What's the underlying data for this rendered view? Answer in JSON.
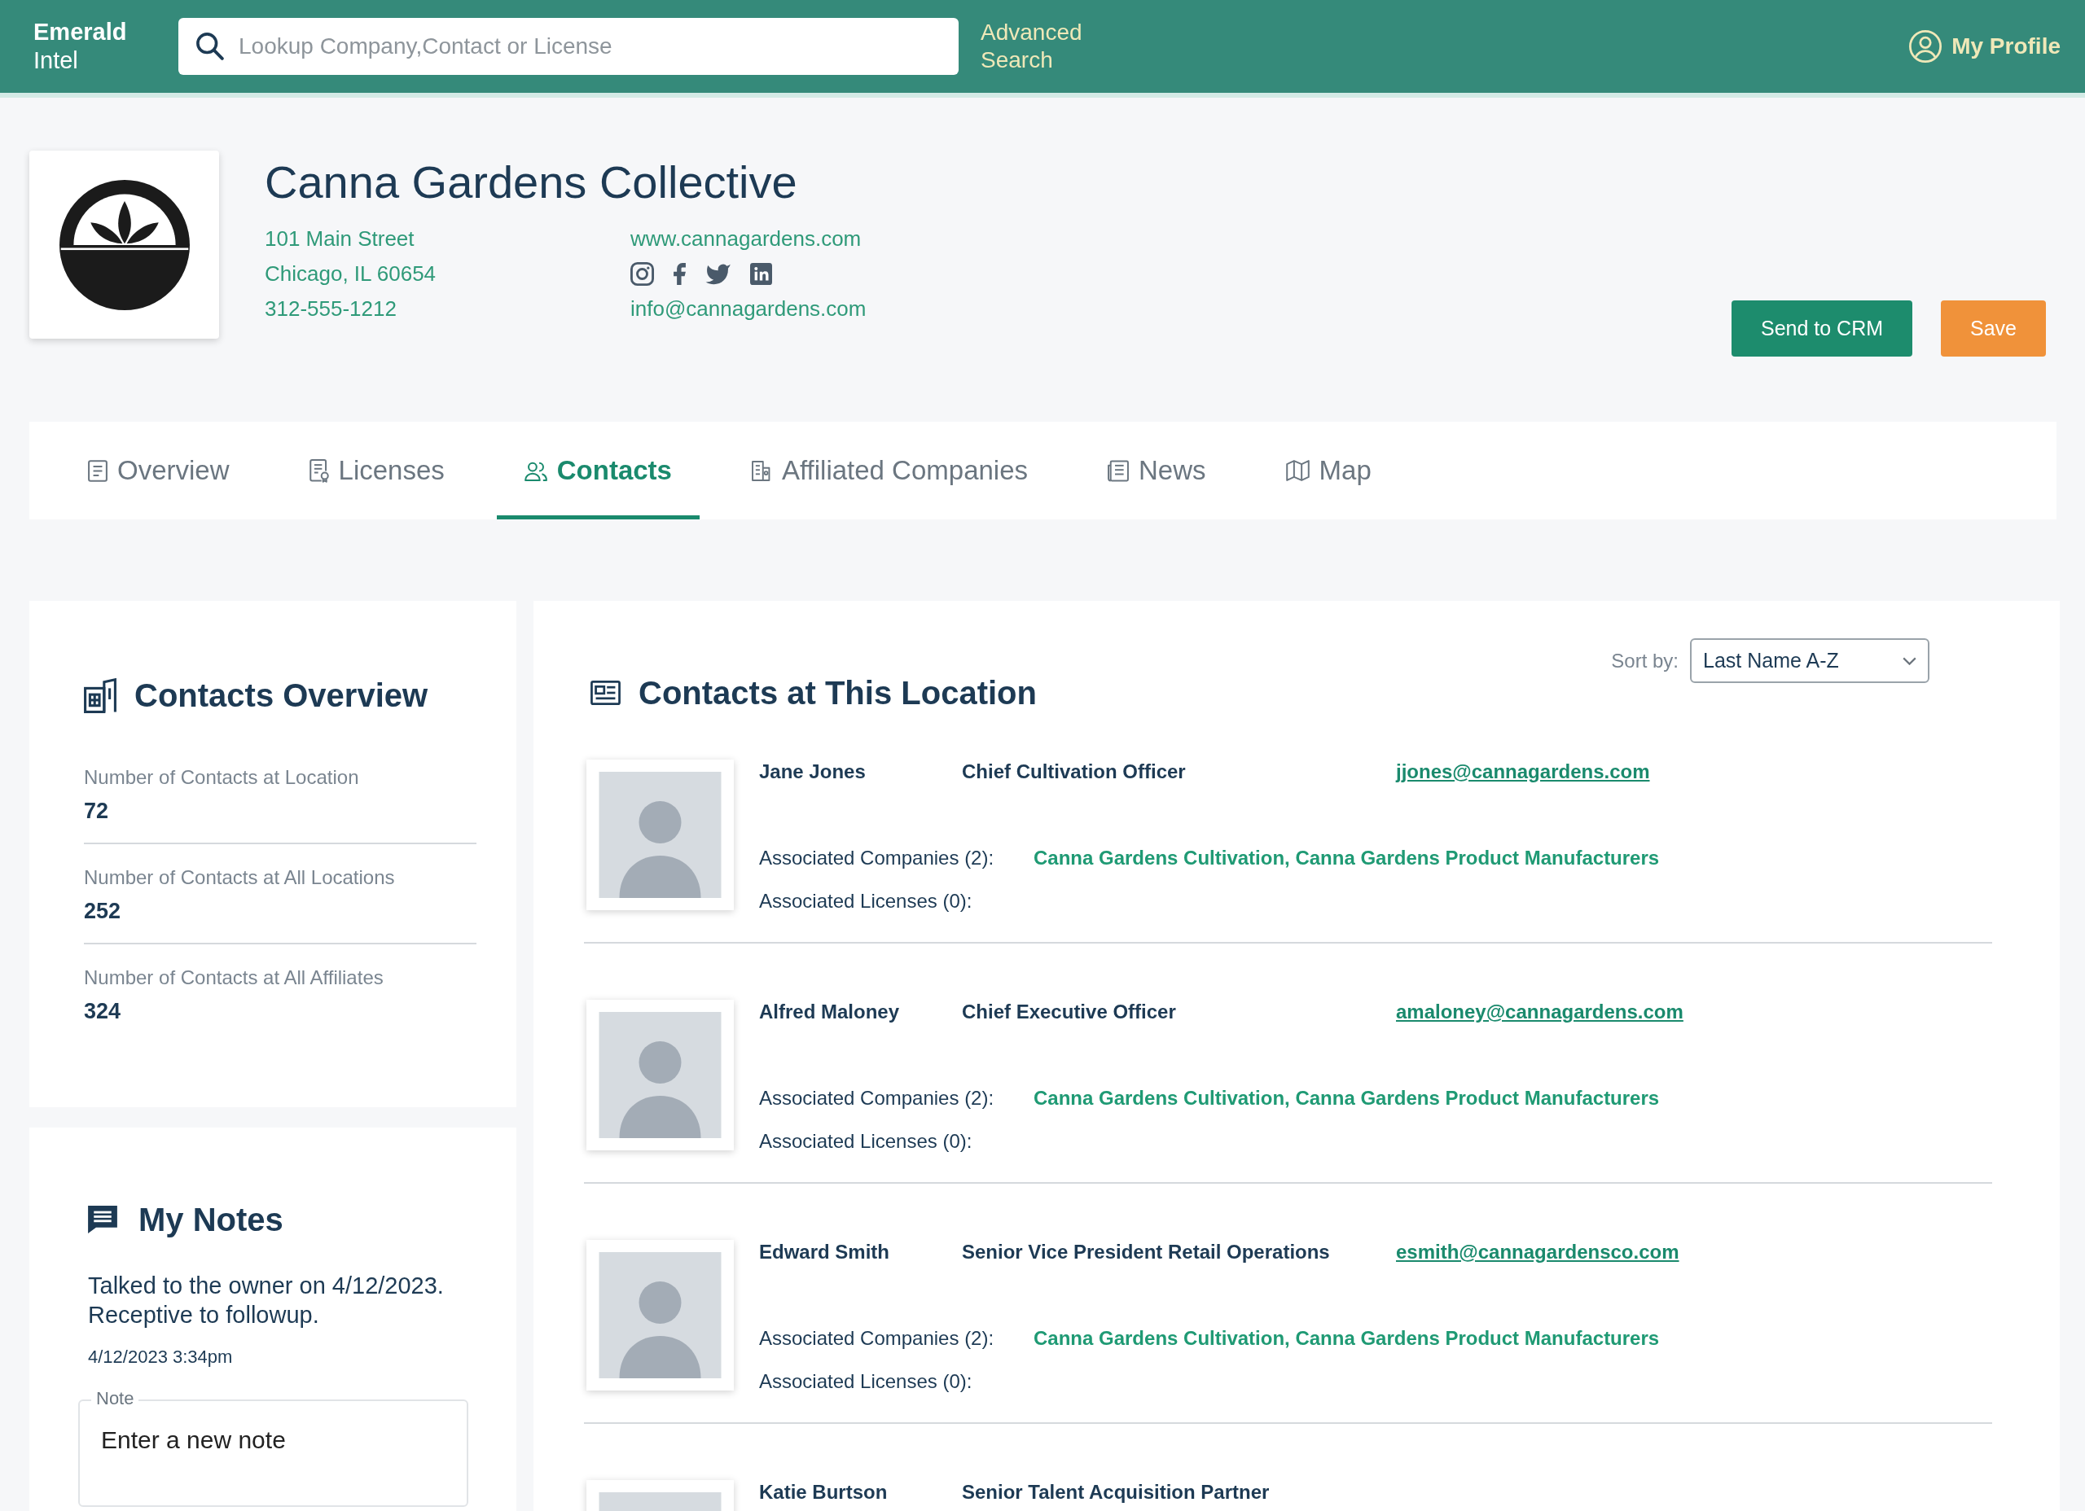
{
  "header": {
    "brand": {
      "name": "Emerald",
      "suffix": "Intel"
    },
    "search": {
      "placeholder": "Lookup Company,Contact or License"
    },
    "advanced_search": "Advanced Search",
    "profile": "My Profile"
  },
  "company": {
    "name": "Canna Gardens Collective",
    "address_lines": [
      "101 Main Street",
      "Chicago, IL 60654"
    ],
    "phone": "312-555-1212",
    "website": "www.cannagardens.com",
    "email": "info@cannagardens.com",
    "buttons": [
      {
        "label": "Send to CRM",
        "kind": "primary"
      },
      {
        "label": "Save",
        "kind": "accent"
      }
    ]
  },
  "tabs": [
    {
      "label": "Overview",
      "selected": false
    },
    {
      "label": "Licenses",
      "selected": false
    },
    {
      "label": "Contacts",
      "selected": true
    },
    {
      "label": "Affiliated Companies",
      "selected": false
    },
    {
      "label": "News",
      "selected": false
    },
    {
      "label": "Map",
      "selected": false
    }
  ],
  "contacts_overview": {
    "title": "Contacts Overview",
    "stats": [
      {
        "label": "Number of Contacts at Location",
        "value": "72"
      },
      {
        "label": "Number of Contacts at All Locations",
        "value": "252"
      },
      {
        "label": "Number of Contacts at All Affiliates",
        "value": "324"
      }
    ]
  },
  "notes": {
    "title": "My Notes",
    "entries": [
      {
        "text": "Talked to the owner on 4/12/2023. Receptive to followup.",
        "time": "4/12/2023 3:34pm"
      }
    ],
    "new_note": {
      "label": "Note",
      "placeholder": "Enter a new note"
    }
  },
  "contacts": {
    "title": "Contacts at This Location",
    "sort": {
      "label": "Sort by:",
      "value": "Last Name A-Z"
    },
    "rows": [
      {
        "name": "Jane Jones",
        "title": "Chief Cultivation Officer",
        "email": "jjones@cannagardens.com",
        "companies_label": "Associated Companies (2):",
        "companies": "Canna Gardens Cultivation, Canna Gardens Product Manufacturers",
        "licenses_label": "Associated Licenses (0):"
      },
      {
        "name": "Alfred Maloney",
        "title": "Chief Executive Officer",
        "email": "amaloney@cannagardens.com",
        "companies_label": "Associated Companies (2):",
        "companies": "Canna Gardens Cultivation, Canna Gardens Product Manufacturers",
        "licenses_label": "Associated Licenses (0):"
      },
      {
        "name": "Edward Smith",
        "title": "Senior Vice President Retail Operations",
        "email": "esmith@cannagardensco.com",
        "companies_label": "Associated Companies (2):",
        "companies": "Canna Gardens Cultivation, Canna Gardens Product Manufacturers",
        "licenses_label": "Associated Licenses (0):"
      },
      {
        "name": "Katie Burtson",
        "title": "Senior Talent Acquisition Partner"
      }
    ]
  }
}
